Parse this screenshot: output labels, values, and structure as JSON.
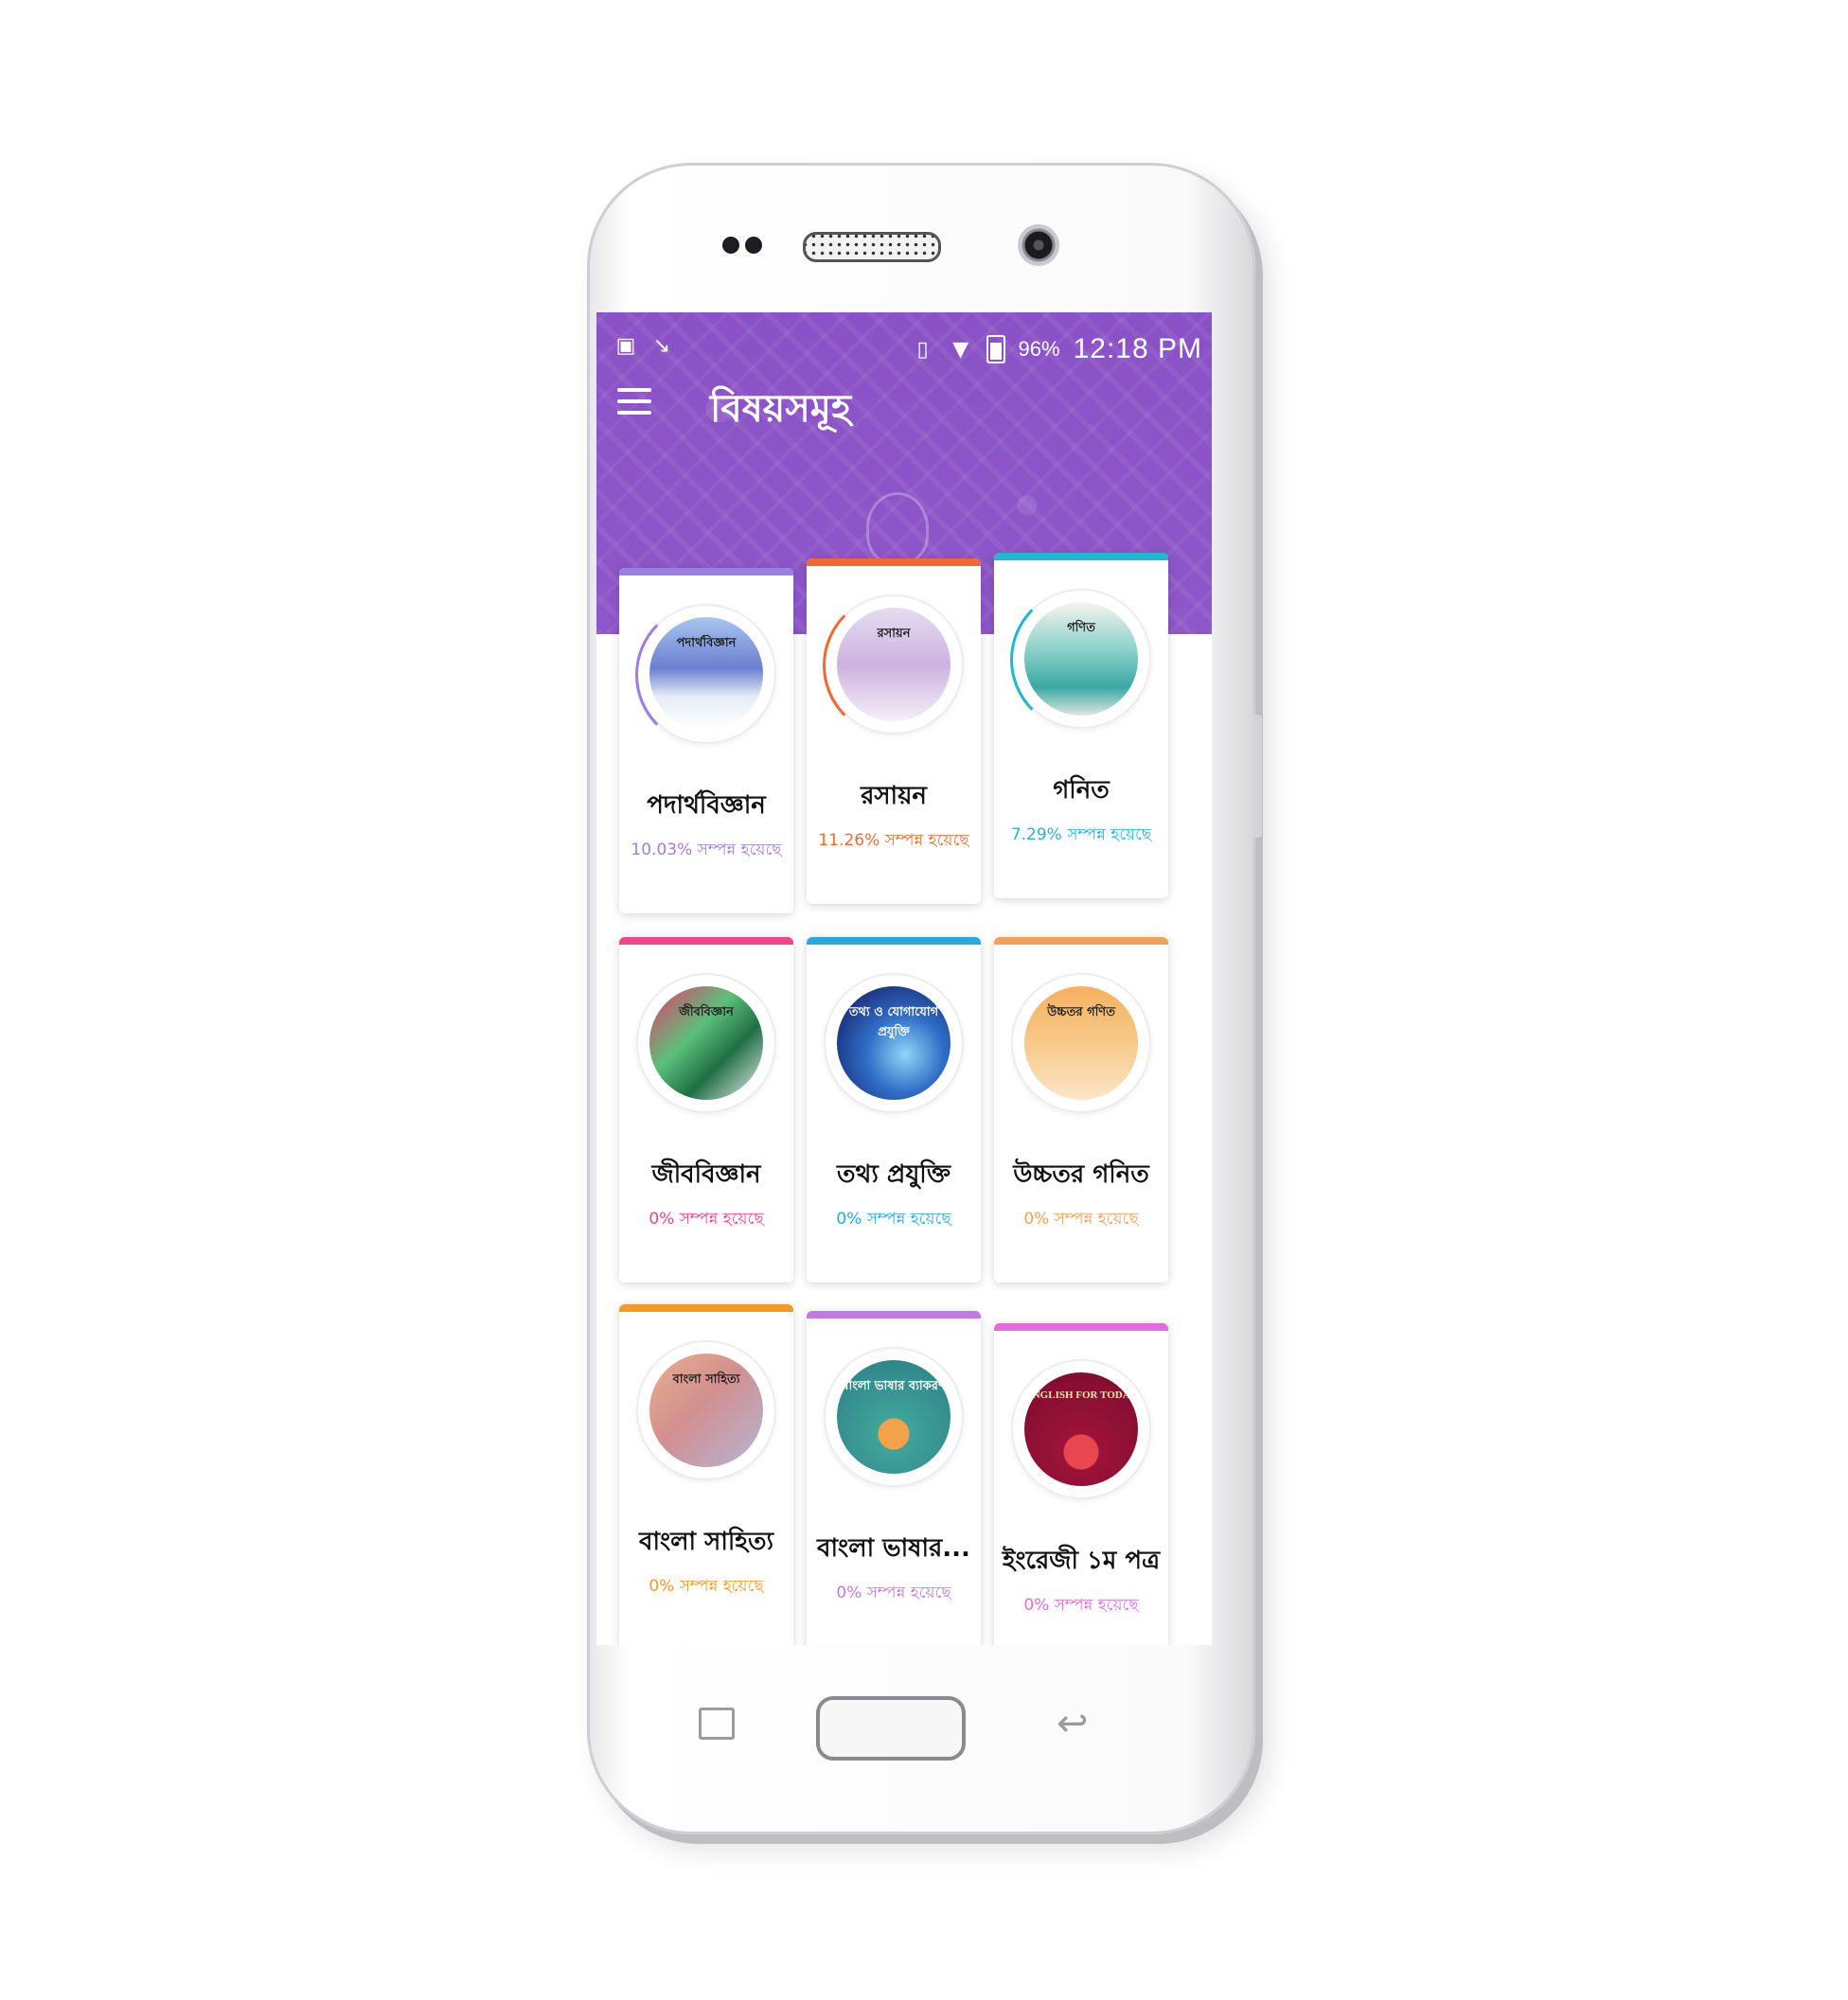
{
  "status_bar": {
    "battery": "96%",
    "time": "12:18 PM",
    "icons": [
      "image-icon",
      "missed-call-icon",
      "vibrate-icon",
      "wifi-icon",
      "battery-icon"
    ]
  },
  "toolbar": {
    "menu_icon": "hamburger-menu-icon",
    "title": "বিষয়সমূহ"
  },
  "colors": {
    "header": "#8a52c6",
    "physics": "#9b7fe0",
    "chemistry": "#f06a2f",
    "math": "#22b6cf",
    "biology": "#f2458a",
    "ict": "#29a9df",
    "higher_math": "#f2a15c",
    "bangla_lit": "#f59a22",
    "bangla_grammar": "#c27ae0",
    "english": "#e56bd8"
  },
  "subjects": [
    {
      "name": "পদার্থবিজ্ঞান",
      "cover_title": "পদার্থবিজ্ঞান",
      "progress": "10.03% সম্পন্ন হয়েছে",
      "color": "#9b7fe0"
    },
    {
      "name": "রসায়ন",
      "cover_title": "রসায়ন",
      "progress": "11.26% সম্পন্ন হয়েছে",
      "color": "#f06a2f"
    },
    {
      "name": "গনিত",
      "cover_title": "গণিত",
      "progress": "7.29% সম্পন্ন হয়েছে",
      "color": "#22b6cf"
    },
    {
      "name": "জীববিজ্ঞান",
      "cover_title": "জীববিজ্ঞান",
      "progress": "0% সম্পন্ন হয়েছে",
      "color": "#f2458a"
    },
    {
      "name": "তথ্য প্রযুক্তি",
      "cover_title": "তথ্য ও যোগাযোগ প্রযুক্তি",
      "progress": "0% সম্পন্ন হয়েছে",
      "color": "#29a9df"
    },
    {
      "name": "উচ্চতর গনিত",
      "cover_title": "উচ্চতর গণিত",
      "progress": "0% সম্পন্ন হয়েছে",
      "color": "#f2a15c"
    },
    {
      "name": "বাংলা সাহিত্য",
      "cover_title": "বাংলা সাহিত্য",
      "progress": "0% সম্পন্ন হয়েছে",
      "color": "#f59a22"
    },
    {
      "name": "বাংলা ভাষার...",
      "cover_title": "বাংলা ভাষার ব্যাকরণ",
      "progress": "0% সম্পন্ন হয়েছে",
      "color": "#c27ae0"
    },
    {
      "name": "ইংরেজী ১ম পত্র",
      "cover_title": "ENGLISH FOR TODAY",
      "progress": "0% সম্পন্ন হয়েছে",
      "color": "#e56bd8"
    }
  ],
  "nav_bar": {
    "recent_icon": "recent-apps-icon",
    "home_icon": "home-button",
    "back_icon": "back-icon"
  }
}
